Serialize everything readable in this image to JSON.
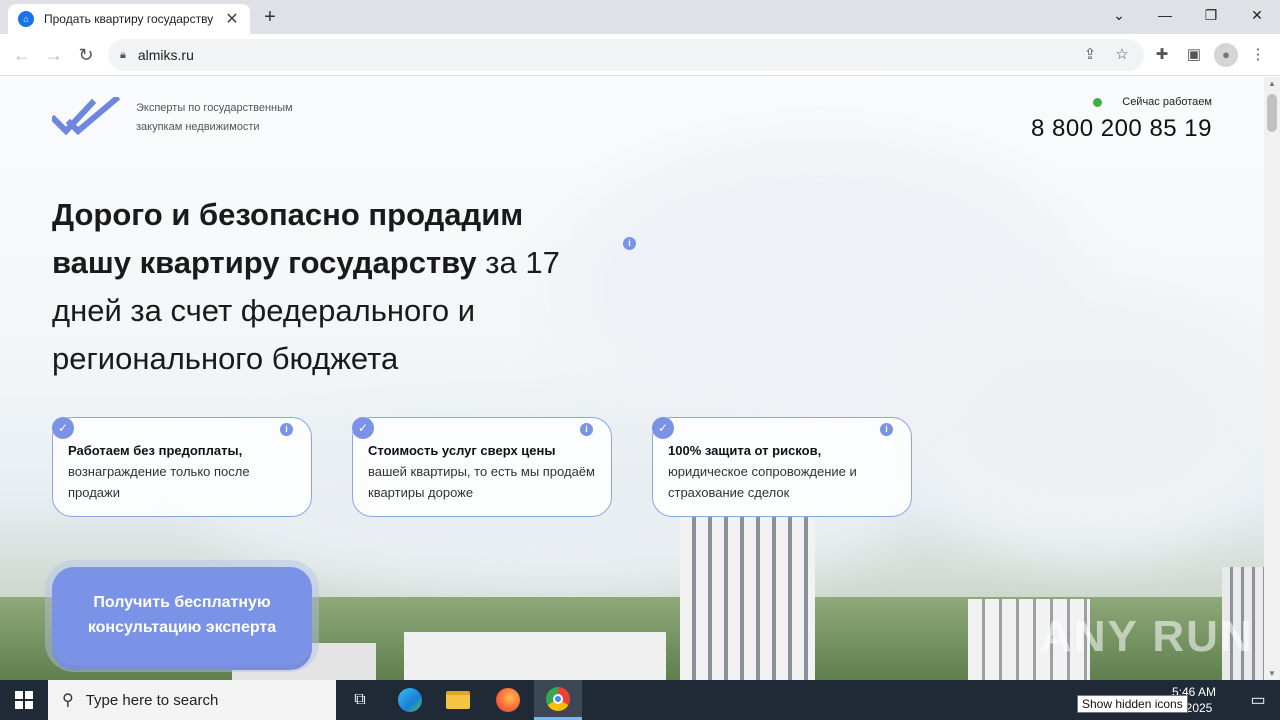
{
  "browser": {
    "tab_title": "Продать квартиру государству",
    "url": "almiks.ru",
    "new_tab_label": "+",
    "tab_close": "✕"
  },
  "site": {
    "logo_text_line1": "Эксперты по государственным",
    "logo_text_line2": "закупкам недвижимости",
    "work_status": "Сейчас работаем",
    "phone": "8 800 200 85 19",
    "headline_bold_1": "Дорого и безопасно продадим",
    "headline_bold_2": "вашу квартиру государству",
    "headline_rest_1": " за 17",
    "headline_rest_2": "дней за счет федерального и",
    "headline_rest_3": "регионального бюджета",
    "info_glyph": "i",
    "check_glyph": "✓",
    "cards": [
      {
        "strong": "Работаем без предоплаты,",
        "text": "вознаграждение только после продажи"
      },
      {
        "strong": "Стоимость услуг сверх цены",
        "text": "вашей квартиры, то есть мы продаём квартиры дороже"
      },
      {
        "strong": "100% защита от рисков,",
        "text": "юридическое сопровождение и страхование сделок"
      }
    ],
    "cta_line1": "Получить бесплатную",
    "cta_line2": "консультацию эксперта",
    "watermark": "ANY RUN"
  },
  "taskbar": {
    "search_placeholder": "Type here to search",
    "time": "5:46 AM",
    "date": "5/2025",
    "tooltip": "Show hidden icons"
  },
  "colors": {
    "accent": "#7a93e6",
    "status_green": "#3cb043",
    "taskbar": "#1f2a36"
  }
}
